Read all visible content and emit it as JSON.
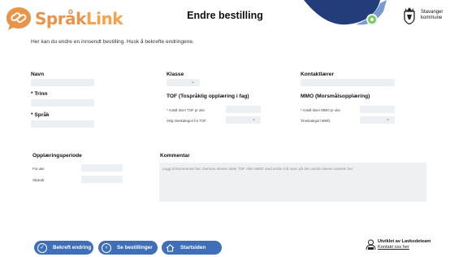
{
  "brand": {
    "part1": "Språk",
    "part2": "Link"
  },
  "page": {
    "title": "Endre bestilling",
    "intro": "Her kan du endre en innsendt bestilling. Husk å bekrefte endringene."
  },
  "municipality": {
    "line1": "Stavanger",
    "line2": "kommune"
  },
  "form": {
    "navn_label": "Navn",
    "trinn_label": "* Trinn",
    "sprak_label": "* Språk",
    "klasse_label": "Klasse",
    "kontaktlaerer_label": "Kontaktlærer",
    "tof": {
      "heading": "TOF (Tospråklig opplæring i fag)",
      "hours_label": "* Antall timer TOF pr uke",
      "category_label": "Velg timekategori for TOF:"
    },
    "mmo": {
      "heading": "MMO (Morsmålsopplæring)",
      "hours_label": "* Antall timer MMO pr uke",
      "category_label": "Timekategori MMO"
    },
    "period": {
      "heading": "Opplæringsperiode",
      "from_label": "Fra uke",
      "to_label": "Skoleår"
    },
    "comment": {
      "heading": "Kommentar",
      "placeholder": "Legg til kommentar her. Dersom eleven deler TOF eller MMO med andre må navn på den andre eleven noteres her"
    }
  },
  "buttons": {
    "confirm": "Bekreft endring",
    "orders": "Se bestillinger",
    "home": "Startsiden"
  },
  "footer": {
    "developed_by": "Utviklet av Lavkodeteam",
    "contact": "Kontakt oss her"
  },
  "colors": {
    "accent": "#3f6fb8",
    "brand_orange": "#e8944a",
    "wave_navy": "#233c7a",
    "field_bg": "#edf0f3"
  },
  "icons": {
    "confirm": "check-icon",
    "orders": "chevron-left-icon",
    "home": "home-icon",
    "owl": "owl-icon"
  }
}
